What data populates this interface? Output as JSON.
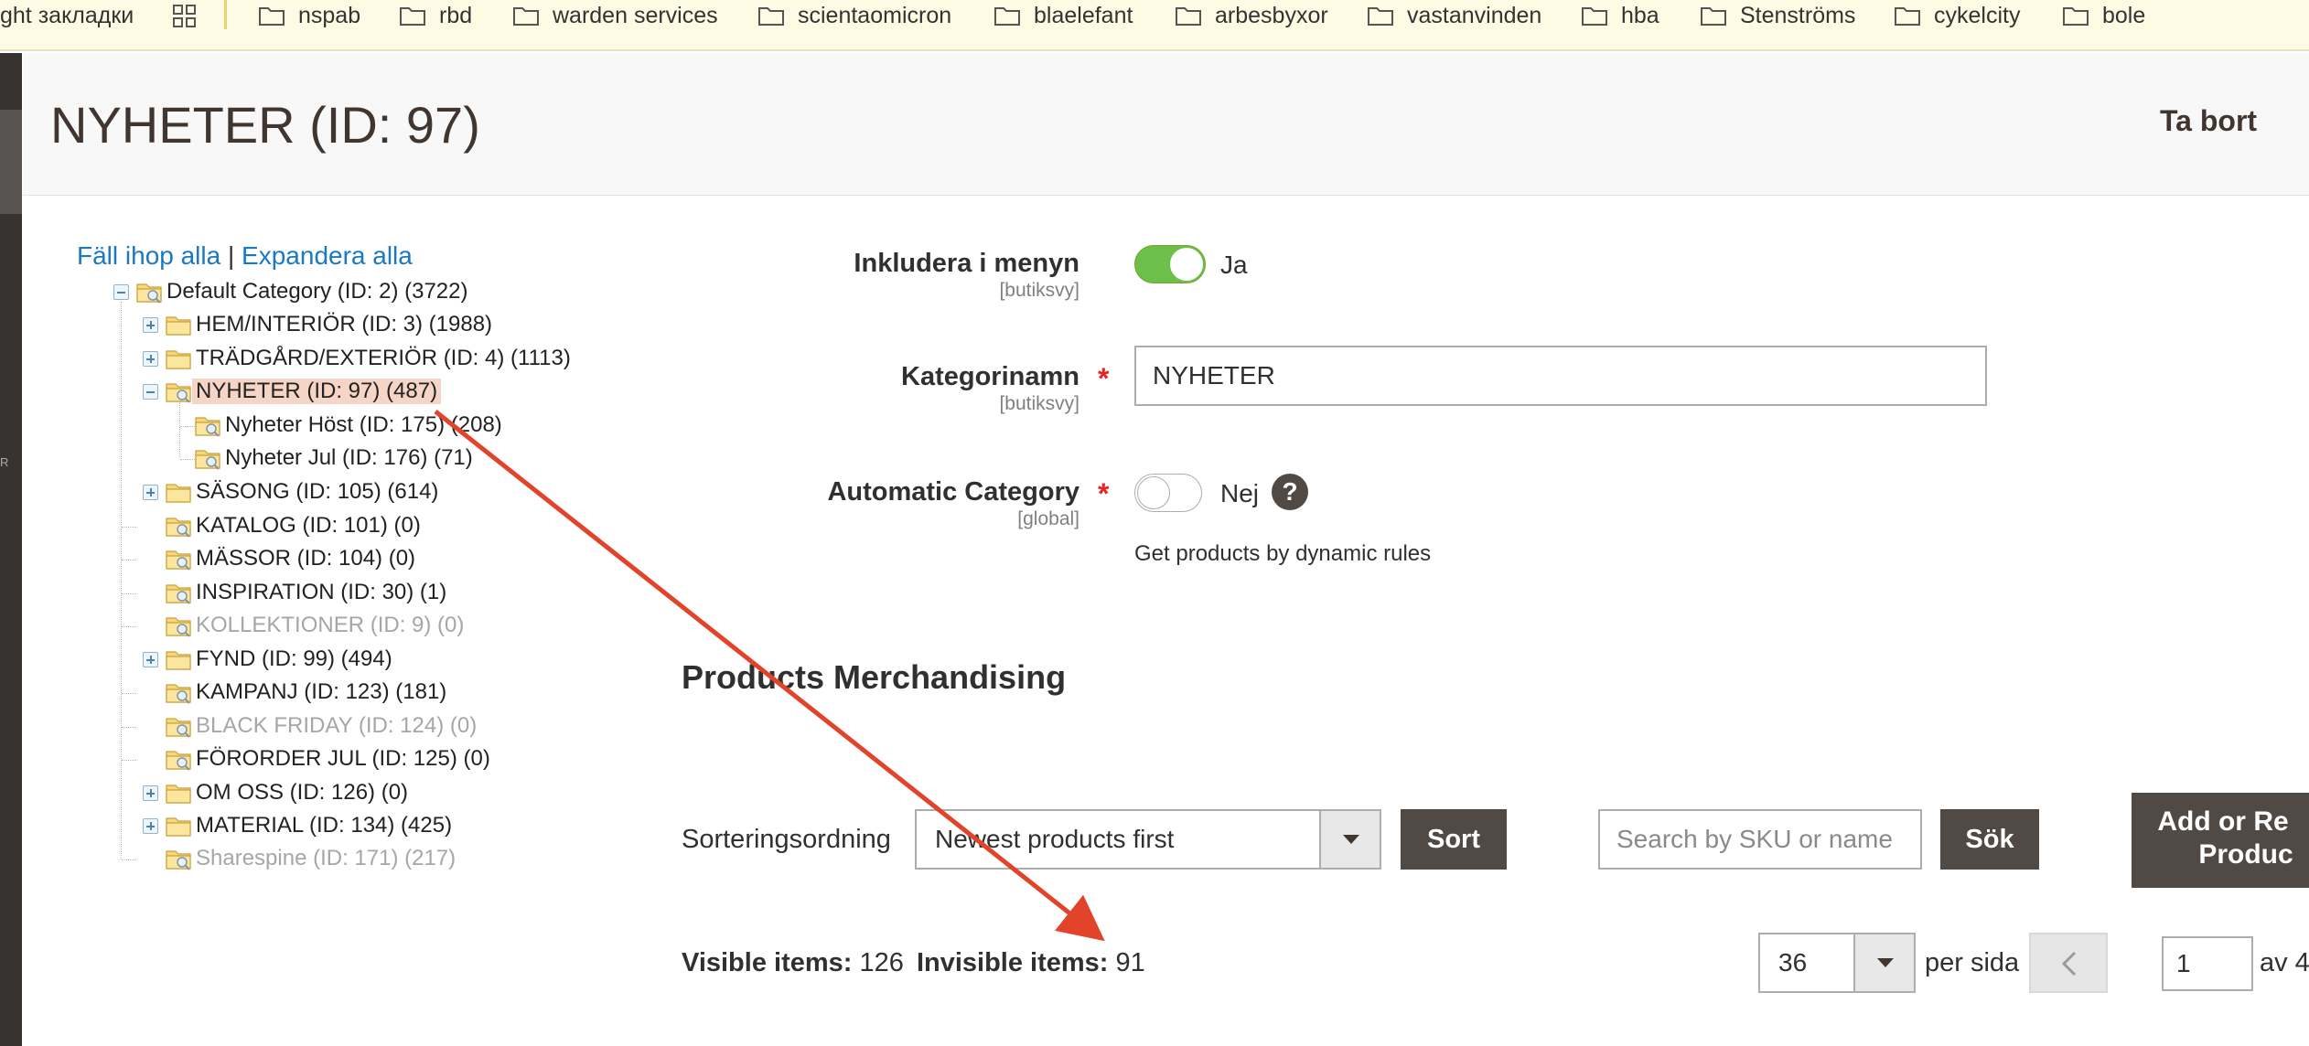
{
  "bookmarks": {
    "partial_first": "ght закладки",
    "folders": [
      "nspab",
      "rbd",
      "warden services",
      "scientaomicron",
      "blaelefant",
      "arbesbyxor",
      "vastanvinden",
      "hba",
      "Stenströms",
      "cykelcity",
      "bole"
    ]
  },
  "header": {
    "title": "NYHETER (ID: 97)",
    "delete_label": "Ta bort"
  },
  "tree": {
    "collapse_all": "Fäll ihop alla",
    "separator": "|",
    "expand_all": "Expandera alla",
    "nodes": [
      {
        "label": "Default Category (ID: 2) (3722)",
        "state": "open"
      },
      {
        "label": "HEM/INTERIÖR (ID: 3) (1988)",
        "state": "closed"
      },
      {
        "label": "TRÄDGÅRD/EXTERIÖR (ID: 4) (1113)",
        "state": "closed"
      },
      {
        "label": "NYHETER (ID: 97) (487)",
        "state": "open",
        "selected": true
      },
      {
        "label": "Nyheter Höst (ID: 175) (208)",
        "state": "leaf"
      },
      {
        "label": "Nyheter Jul (ID: 176) (71)",
        "state": "leaf"
      },
      {
        "label": "SÄSONG (ID: 105) (614)",
        "state": "closed"
      },
      {
        "label": "KATALOG (ID: 101) (0)",
        "state": "leaf"
      },
      {
        "label": "MÄSSOR (ID: 104) (0)",
        "state": "leaf"
      },
      {
        "label": "INSPIRATION (ID: 30) (1)",
        "state": "leaf"
      },
      {
        "label": "KOLLEKTIONER (ID: 9) (0)",
        "state": "leaf",
        "disabled": true
      },
      {
        "label": "FYND (ID: 99) (494)",
        "state": "closed"
      },
      {
        "label": "KAMPANJ (ID: 123) (181)",
        "state": "leaf"
      },
      {
        "label": "BLACK FRIDAY (ID: 124) (0)",
        "state": "leaf",
        "disabled": true
      },
      {
        "label": "FÖRORDER JUL (ID: 125) (0)",
        "state": "leaf"
      },
      {
        "label": "OM OSS (ID: 126) (0)",
        "state": "closed"
      },
      {
        "label": "MATERIAL (ID: 134) (425)",
        "state": "closed"
      },
      {
        "label": "Sharespine (ID: 171) (217)",
        "state": "leaf",
        "disabled": true
      }
    ]
  },
  "form": {
    "include_menu": {
      "label": "Inkludera i menyn",
      "scope": "[butiksvy]",
      "value": "Ja",
      "enabled": true
    },
    "category_name": {
      "label": "Kategorinamn",
      "scope": "[butiksvy]",
      "value": "NYHETER",
      "required_mark": "*"
    },
    "automatic_category": {
      "label": "Automatic Category",
      "scope": "[global]",
      "value": "Nej",
      "enabled": false,
      "required_mark": "*",
      "help": "?",
      "note": "Get products by dynamic rules"
    }
  },
  "merchandising": {
    "title": "Products Merchandising",
    "sort_label": "Sorteringsordning",
    "sort_value": "Newest products first",
    "sort_button": "Sort",
    "search_placeholder": "Search by SKU or name",
    "search_button": "Sök",
    "add_button_line1": "Add or Re",
    "add_button_line2": "Produc",
    "visible_label": "Visible items:",
    "visible_value": "126",
    "invisible_label": "Invisible items:",
    "invisible_value": "91",
    "per_page_value": "36",
    "per_page_label": "per sida",
    "page_value": "1",
    "page_of": "av 4"
  },
  "colors": {
    "accent_link": "#1979c3",
    "annotation_arrow": "#e2442b",
    "toggle_on": "#6cbf4a",
    "dark_button": "#514943",
    "selected_node": "#f5d6c6"
  }
}
